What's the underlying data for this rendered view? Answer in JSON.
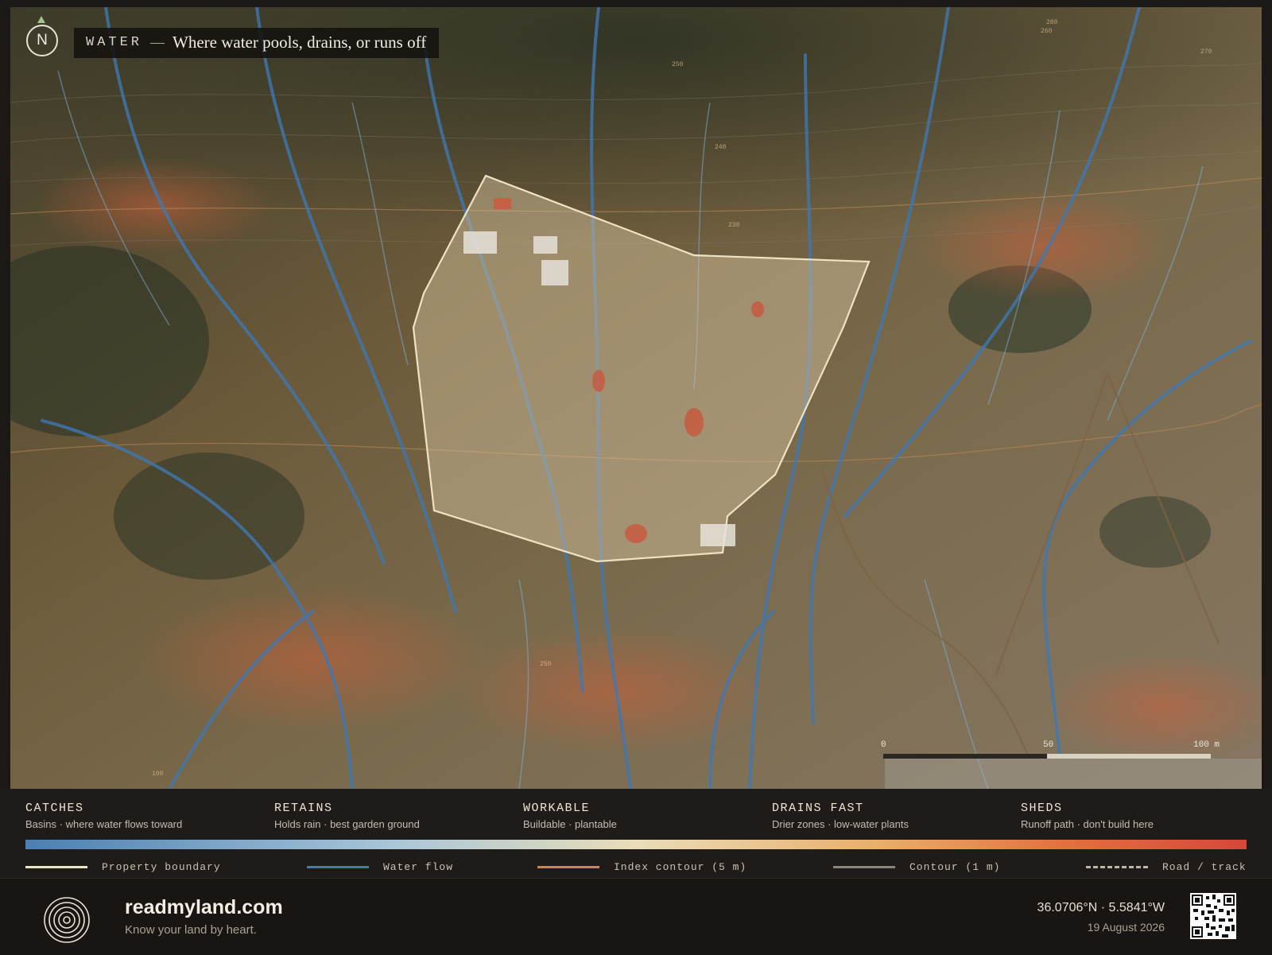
{
  "map": {
    "north_label": "N",
    "title_word": "WATER",
    "title_dash": "—",
    "title_sub": "Where water pools, drains, or runs off",
    "scale": {
      "ticks": [
        "0",
        "50",
        "100 m"
      ]
    },
    "contour_labels": [
      "280",
      "260",
      "270",
      "250",
      "240",
      "230",
      "250",
      "100"
    ]
  },
  "legend": {
    "categories": [
      {
        "name": "CATCHES",
        "desc": "Basins · where water flows toward",
        "color": "#4a7fb2"
      },
      {
        "name": "RETAINS",
        "desc": "Holds rain · best garden ground",
        "color": "#a9c6d8"
      },
      {
        "name": "WORKABLE",
        "desc": "Buildable · plantable",
        "color": "#e9ddb8"
      },
      {
        "name": "DRAINS FAST",
        "desc": "Drier zones · low-water plants",
        "color": "#e9ae6a"
      },
      {
        "name": "SHEDS",
        "desc": "Runoff path · don't build here",
        "color": "#d6473a"
      }
    ],
    "keys": [
      {
        "label": "Property boundary",
        "color": "#efe3c3"
      },
      {
        "label": "Water flow",
        "color": "#4a79a8"
      },
      {
        "label": "Index contour (5 m)",
        "color": "#c38a55"
      },
      {
        "label": "Contour (1 m)",
        "color": "#8a857c"
      },
      {
        "label": "Road / track",
        "color": "#bdb6a8"
      }
    ]
  },
  "footer": {
    "brand": "readmyland.com",
    "tagline": "Know your land by heart.",
    "coords": "36.0706°N · 5.5841°W",
    "date": "19 August 2026"
  }
}
